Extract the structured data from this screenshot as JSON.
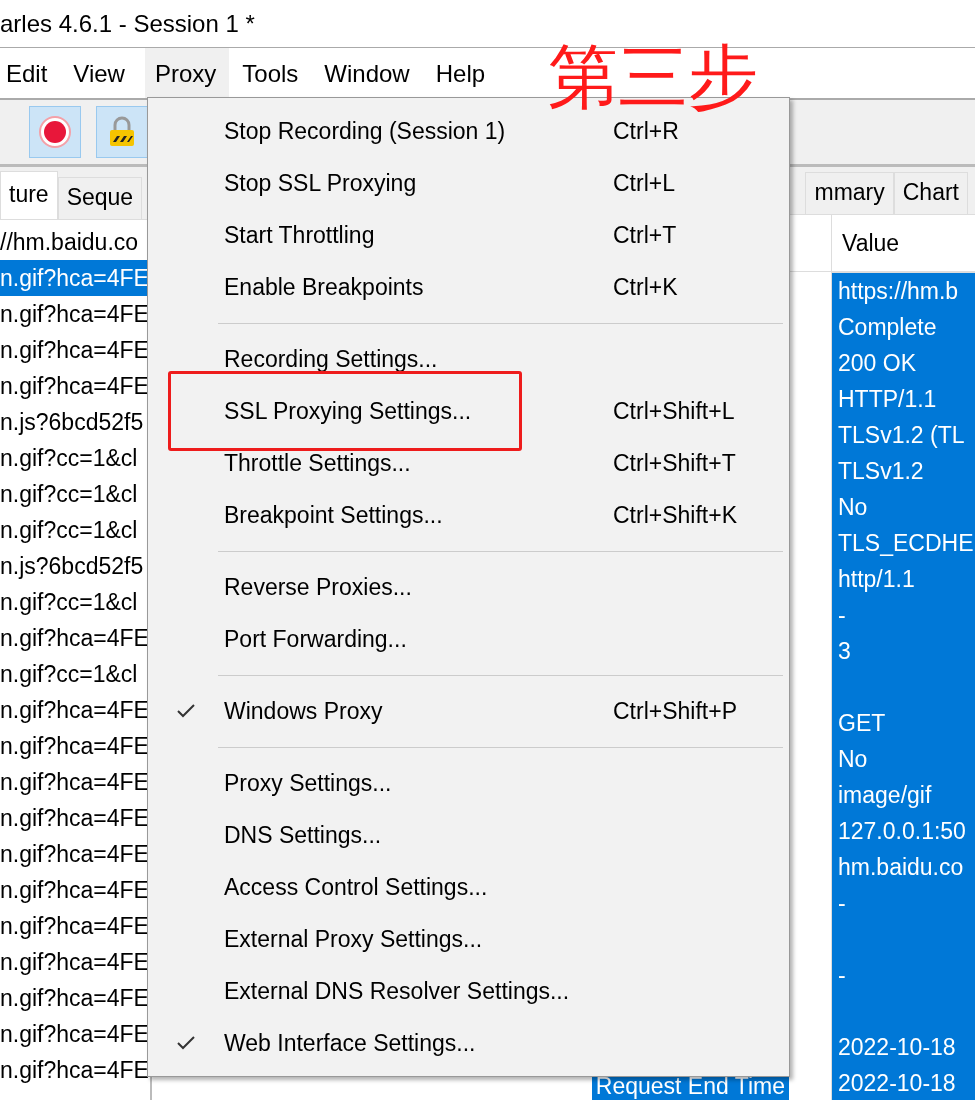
{
  "window": {
    "title": "arles 4.6.1 - Session 1 *"
  },
  "menubar": [
    {
      "label": "Edit",
      "selected": false
    },
    {
      "label": "View",
      "selected": false
    },
    {
      "label": "Proxy",
      "selected": true
    },
    {
      "label": "Tools",
      "selected": false
    },
    {
      "label": "Window",
      "selected": false
    },
    {
      "label": "Help",
      "selected": false
    }
  ],
  "annotation": {
    "text": "第三步"
  },
  "toolbar": [
    {
      "kind": "record"
    },
    {
      "kind": "lock"
    }
  ],
  "left_tabs": [
    {
      "label": "ture",
      "selected": true
    },
    {
      "label": "Seque",
      "selected": false
    }
  ],
  "request_list": [
    {
      "text": "//hm.baidu.co",
      "selected": false
    },
    {
      "text": "n.gif?hca=4FE",
      "selected": true
    },
    {
      "text": "n.gif?hca=4FE",
      "selected": false
    },
    {
      "text": "n.gif?hca=4FE",
      "selected": false
    },
    {
      "text": "n.gif?hca=4FE",
      "selected": false
    },
    {
      "text": "n.js?6bcd52f5",
      "selected": false
    },
    {
      "text": "n.gif?cc=1&cl",
      "selected": false
    },
    {
      "text": "n.gif?cc=1&cl",
      "selected": false
    },
    {
      "text": "n.gif?cc=1&cl",
      "selected": false
    },
    {
      "text": "n.js?6bcd52f5",
      "selected": false
    },
    {
      "text": "n.gif?cc=1&cl",
      "selected": false
    },
    {
      "text": "n.gif?hca=4FE",
      "selected": false
    },
    {
      "text": "n.gif?cc=1&cl",
      "selected": false
    },
    {
      "text": "n.gif?hca=4FE",
      "selected": false
    },
    {
      "text": "n.gif?hca=4FE",
      "selected": false
    },
    {
      "text": "n.gif?hca=4FE",
      "selected": false
    },
    {
      "text": "n.gif?hca=4FE",
      "selected": false
    },
    {
      "text": "n.gif?hca=4FE",
      "selected": false
    },
    {
      "text": "n.gif?hca=4FE",
      "selected": false
    },
    {
      "text": "n.gif?hca=4FE",
      "selected": false
    },
    {
      "text": "n.gif?hca=4FE",
      "selected": false
    },
    {
      "text": "n.gif?hca=4FE",
      "selected": false
    },
    {
      "text": "n.gif?hca=4FE",
      "selected": false
    },
    {
      "text": "n.gif?hca=4FE",
      "selected": false
    }
  ],
  "right_tabs": [
    {
      "label": "mmary",
      "selected": false
    },
    {
      "label": "Chart",
      "selected": false
    }
  ],
  "details": {
    "value_header": "Value",
    "name_rows": [
      {
        "text": "Request End Time",
        "selected": true
      }
    ],
    "values": [
      {
        "kind": "value",
        "text": "https://hm.b"
      },
      {
        "kind": "value",
        "text": "Complete"
      },
      {
        "kind": "value",
        "text": "200 OK"
      },
      {
        "kind": "value",
        "text": "HTTP/1.1"
      },
      {
        "kind": "value",
        "text": "TLSv1.2 (TL"
      },
      {
        "kind": "value",
        "text": "TLSv1.2"
      },
      {
        "kind": "value",
        "text": "No"
      },
      {
        "kind": "value",
        "text": "TLS_ECDHE"
      },
      {
        "kind": "value",
        "text": "http/1.1"
      },
      {
        "kind": "value",
        "text": "-"
      },
      {
        "kind": "value",
        "text": "3"
      },
      {
        "kind": "blank"
      },
      {
        "kind": "value",
        "text": "GET"
      },
      {
        "kind": "value",
        "text": "No"
      },
      {
        "kind": "value",
        "text": "image/gif"
      },
      {
        "kind": "value",
        "text": "127.0.0.1:50"
      },
      {
        "kind": "value",
        "text": "hm.baidu.co"
      },
      {
        "kind": "value",
        "text": "-"
      },
      {
        "kind": "blank"
      },
      {
        "kind": "value",
        "text": "-"
      },
      {
        "kind": "blank"
      },
      {
        "kind": "value",
        "text": "2022-10-18"
      },
      {
        "kind": "value",
        "text": "2022-10-18"
      }
    ]
  },
  "proxy_menu": [
    {
      "kind": "item",
      "label": "Stop Recording (Session 1)",
      "shortcut": "Ctrl+R",
      "checked": false
    },
    {
      "kind": "item",
      "label": "Stop SSL Proxying",
      "shortcut": "Ctrl+L",
      "checked": false
    },
    {
      "kind": "item",
      "label": "Start Throttling",
      "shortcut": "Ctrl+T",
      "checked": false
    },
    {
      "kind": "item",
      "label": "Enable Breakpoints",
      "shortcut": "Ctrl+K",
      "checked": false
    },
    {
      "kind": "separator"
    },
    {
      "kind": "item",
      "label": "Recording Settings...",
      "checked": false
    },
    {
      "kind": "item",
      "label": "SSL Proxying Settings...",
      "shortcut": "Ctrl+Shift+L",
      "checked": false
    },
    {
      "kind": "item",
      "label": "Throttle Settings...",
      "shortcut": "Ctrl+Shift+T",
      "checked": false
    },
    {
      "kind": "item",
      "label": "Breakpoint Settings...",
      "shortcut": "Ctrl+Shift+K",
      "checked": false
    },
    {
      "kind": "separator"
    },
    {
      "kind": "item",
      "label": "Reverse Proxies...",
      "checked": false
    },
    {
      "kind": "item",
      "label": "Port Forwarding...",
      "checked": false
    },
    {
      "kind": "separator"
    },
    {
      "kind": "item",
      "label": "Windows Proxy",
      "shortcut": "Ctrl+Shift+P",
      "checked": true
    },
    {
      "kind": "separator"
    },
    {
      "kind": "item",
      "label": "Proxy Settings...",
      "checked": false
    },
    {
      "kind": "item",
      "label": "DNS Settings...",
      "checked": false
    },
    {
      "kind": "item",
      "label": "Access Control Settings...",
      "checked": false
    },
    {
      "kind": "item",
      "label": "External Proxy Settings...",
      "checked": false
    },
    {
      "kind": "item",
      "label": "External DNS Resolver Settings...",
      "checked": false
    },
    {
      "kind": "item",
      "label": "Web Interface Settings...",
      "checked": true
    }
  ]
}
